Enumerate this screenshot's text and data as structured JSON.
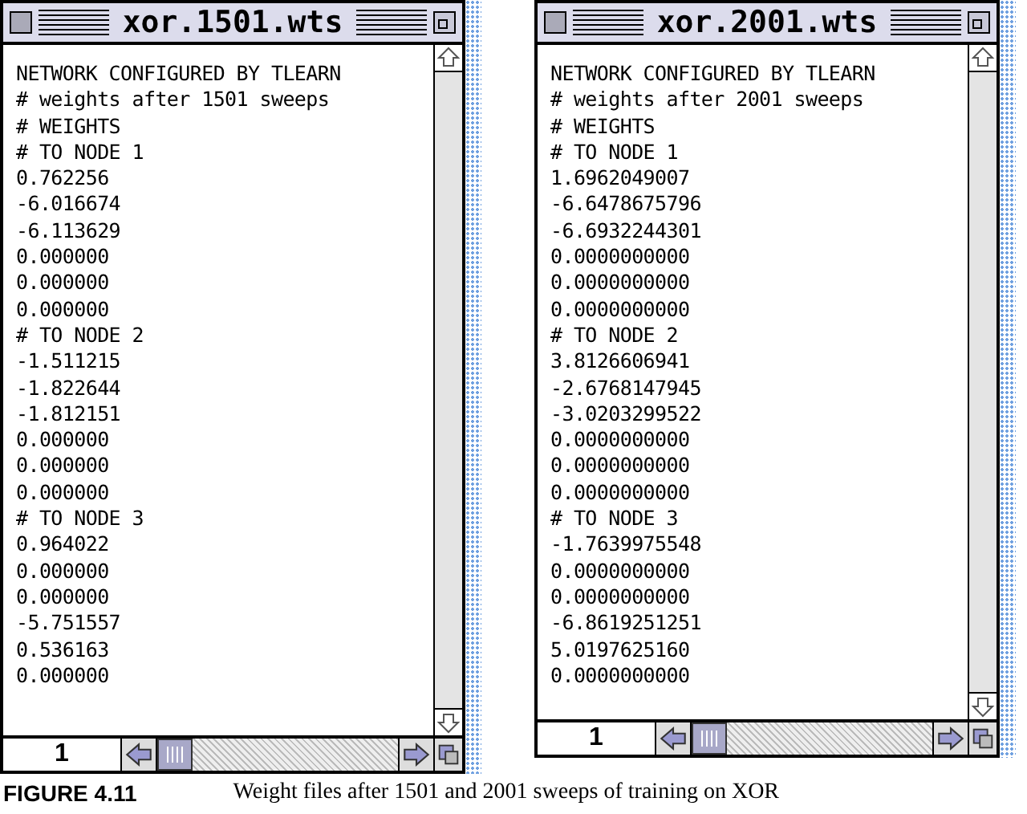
{
  "windows": [
    {
      "title": "xor.1501.wts",
      "lines": [
        "NETWORK CONFIGURED BY TLEARN",
        "# weights after 1501 sweeps",
        "# WEIGHTS",
        "# TO NODE 1",
        "0.762256",
        "-6.016674",
        "-6.113629",
        "0.000000",
        "0.000000",
        "0.000000",
        "# TO NODE 2",
        "-1.511215",
        "-1.822644",
        "-1.812151",
        "0.000000",
        "0.000000",
        "0.000000",
        "# TO NODE 3",
        "0.964022",
        "0.000000",
        "0.000000",
        "-5.751557",
        "0.536163",
        "0.000000"
      ],
      "page": "1"
    },
    {
      "title": "xor.2001.wts",
      "lines": [
        "NETWORK CONFIGURED BY TLEARN",
        "# weights after 2001 sweeps",
        "# WEIGHTS",
        "# TO NODE 1",
        "1.6962049007",
        "-6.6478675796",
        "-6.6932244301",
        "0.0000000000",
        "0.0000000000",
        "0.0000000000",
        "# TO NODE 2",
        "3.8126606941",
        "-2.6768147945",
        "-3.0203299522",
        "0.0000000000",
        "0.0000000000",
        "0.0000000000",
        "# TO NODE 3",
        "-1.7639975548",
        "0.0000000000",
        "0.0000000000",
        "-6.8619251251",
        "5.0197625160",
        "0.0000000000"
      ],
      "page": "1"
    }
  ],
  "caption": {
    "label": "FIGURE 4.11",
    "text": "Weight files after 1501 and 2001 sweeps of training on XOR"
  }
}
